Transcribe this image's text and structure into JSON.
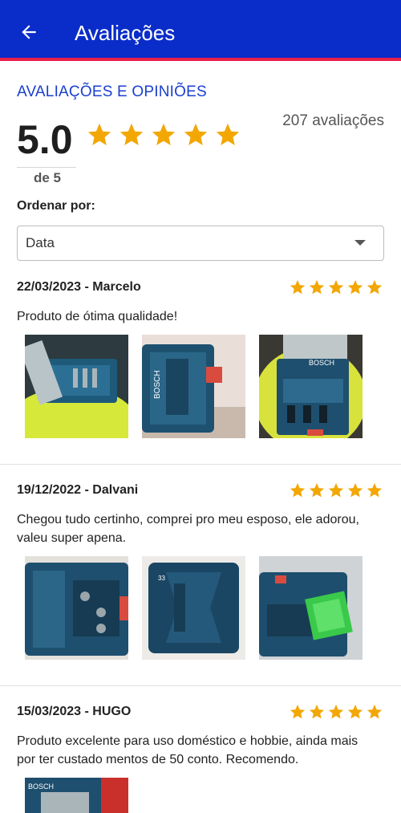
{
  "header": {
    "title": "Avaliações",
    "back_icon": "arrow-left-icon"
  },
  "summary": {
    "section_title": "AVALIAÇÕES E OPINIÕES",
    "rating": "5.0",
    "rating_out_of": "de 5",
    "count": "207 avaliações",
    "stars": 5
  },
  "sort": {
    "label": "Ordenar por:",
    "value": "Data"
  },
  "colors": {
    "brand": "#0a2cc9",
    "accent": "#e8204a",
    "star": "#f2a705",
    "title": "#1a3fd0"
  },
  "reviews": [
    {
      "date_author": "22/03/2023 - Marcelo",
      "stars": 5,
      "text": "Produto de ótima qualidade!"
    },
    {
      "date_author": "19/12/2022 - Dalvani",
      "stars": 5,
      "text": "Chegou tudo certinho, comprei pro meu esposo, ele adorou, valeu super apena."
    },
    {
      "date_author": "15/03/2023 - HUGO",
      "stars": 5,
      "text": "Produto excelente para uso doméstico e hobbie, ainda mais por ter custado mentos de 50 conto. Recomendo."
    }
  ]
}
